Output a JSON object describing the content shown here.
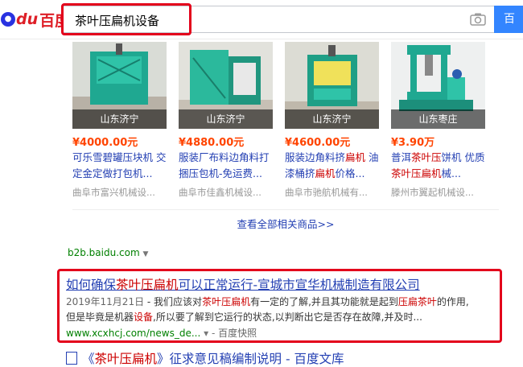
{
  "header": {
    "logo_latin": "du",
    "logo_cn": "百度",
    "search_value": "茶叶压扁机设备",
    "search_button": "百"
  },
  "products": [
    {
      "location": "山东济宁",
      "price": "¥4000.00元",
      "title_parts": [
        "可乐雪碧罐压块机 交定金定做打包机..."
      ],
      "seller": "曲阜市富兴机械设..."
    },
    {
      "location": "山东济宁",
      "price": "¥4880.00元",
      "title_parts": [
        "服装厂布料边角料打捆压包机-免运费..."
      ],
      "seller": "曲阜市佳鑫机械设..."
    },
    {
      "location": "山东济宁",
      "price": "¥4600.00元",
      "title_a": "服装边角料挤",
      "title_b": "扁机",
      "title_c": " 油漆桶挤",
      "title_d": "扁机",
      "title_e": "价格...",
      "seller": "曲阜市驰航机械有..."
    },
    {
      "location": "山东枣庄",
      "price": "¥3.90万",
      "title_a": "普洱",
      "title_b": "茶叶压",
      "title_c": "饼机 优质",
      "title_d": "茶叶压扁机",
      "title_e": "械...",
      "seller": "滕州市翼起机械设..."
    }
  ],
  "view_all": "查看全部相关商品>>",
  "b2b_url": "b2b.baidu.com",
  "result": {
    "title_a": "如何确保",
    "title_b": "茶叶压扁机",
    "title_c": "可以正常运行-宣城市宣华机械制造有限公司",
    "date": "2019年11月21日",
    "desc_a": " - 我们应该对",
    "desc_b": "茶叶压扁机",
    "desc_c": "有一定的了解,并且其功能就是起到",
    "desc_d": "压扁茶叶",
    "desc_e": "的作用,",
    "desc_f": "但是毕竟是机器",
    "desc_g": "设备",
    "desc_h": ",所以要了解到它运行的状态,以判断出它是否存在故障,并及时...",
    "url": "www.xcxhcj.com/news_de...",
    "kuaizhao": "百度快照"
  },
  "next_result": {
    "title_a": "《",
    "title_b": "茶叶压扁机",
    "title_c": "》征求意见稿编制说明 - 百度文库"
  },
  "colors": {
    "link": "#2440b3",
    "highlight": "#cc0000",
    "url_green": "#008000",
    "price": "#ff4400",
    "annotation_red": "#e3001b",
    "baidu_blue": "#3385ff"
  }
}
